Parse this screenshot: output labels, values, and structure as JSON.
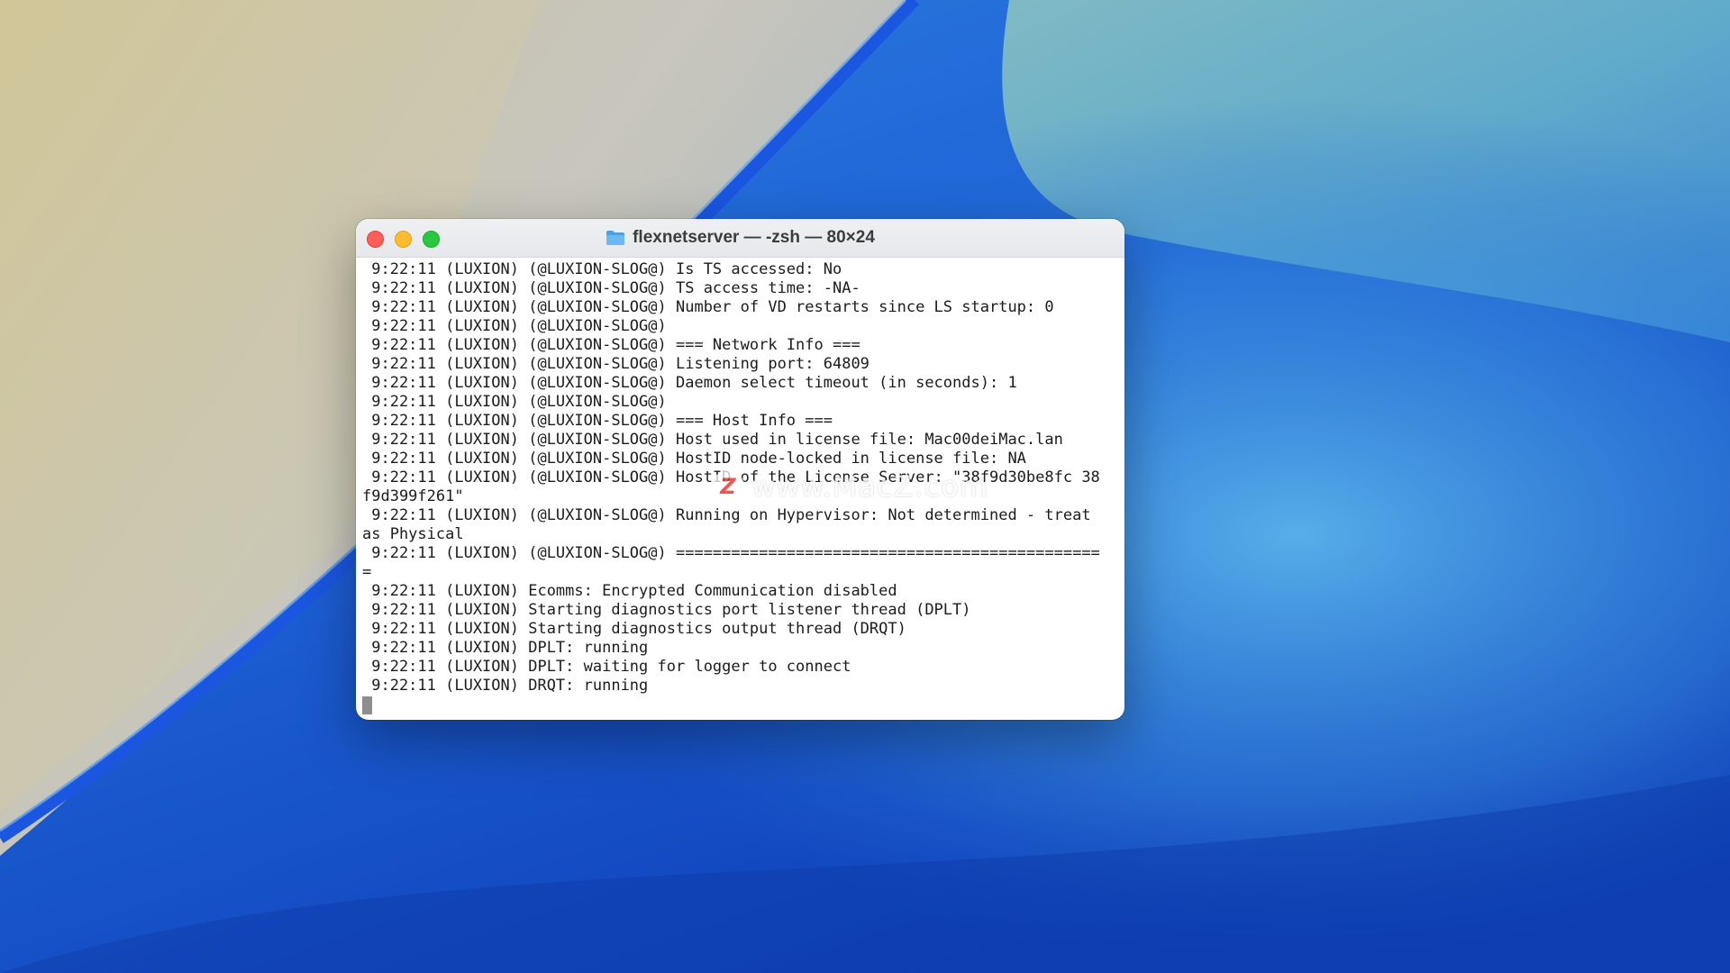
{
  "window": {
    "title": "flexnetserver — -zsh — 80×24"
  },
  "terminal": {
    "lines": [
      " 9:22:11 (LUXION) (@LUXION-SLOG@) Is TS accessed: No",
      " 9:22:11 (LUXION) (@LUXION-SLOG@) TS access time: -NA-",
      " 9:22:11 (LUXION) (@LUXION-SLOG@) Number of VD restarts since LS startup: 0",
      " 9:22:11 (LUXION) (@LUXION-SLOG@)",
      " 9:22:11 (LUXION) (@LUXION-SLOG@) === Network Info ===",
      " 9:22:11 (LUXION) (@LUXION-SLOG@) Listening port: 64809",
      " 9:22:11 (LUXION) (@LUXION-SLOG@) Daemon select timeout (in seconds): 1",
      " 9:22:11 (LUXION) (@LUXION-SLOG@)",
      " 9:22:11 (LUXION) (@LUXION-SLOG@) === Host Info ===",
      " 9:22:11 (LUXION) (@LUXION-SLOG@) Host used in license file: Mac00deiMac.lan",
      " 9:22:11 (LUXION) (@LUXION-SLOG@) HostID node-locked in license file: NA",
      " 9:22:11 (LUXION) (@LUXION-SLOG@) HostID of the License Server: \"38f9d30be8fc 38",
      "f9d399f261\"",
      " 9:22:11 (LUXION) (@LUXION-SLOG@) Running on Hypervisor: Not determined - treat",
      "as Physical",
      " 9:22:11 (LUXION) (@LUXION-SLOG@) ==============================================",
      "=",
      " 9:22:11 (LUXION) Ecomms: Encrypted Communication disabled",
      " 9:22:11 (LUXION) Starting diagnostics port listener thread (DPLT)",
      " 9:22:11 (LUXION) Starting diagnostics output thread (DRQT)",
      " 9:22:11 (LUXION) DPLT: running",
      " 9:22:11 (LUXION) DPLT: waiting for logger to connect",
      " 9:22:11 (LUXION) DRQT: running"
    ]
  },
  "watermark": {
    "logo_letter": "Z",
    "text": "www.MacZ.com"
  },
  "colors": {
    "close": "#ff5f57",
    "minimize": "#febc2e",
    "maximize": "#28c840",
    "folder": "#5aa9e6"
  },
  "icons": {
    "title": "folder-icon"
  }
}
